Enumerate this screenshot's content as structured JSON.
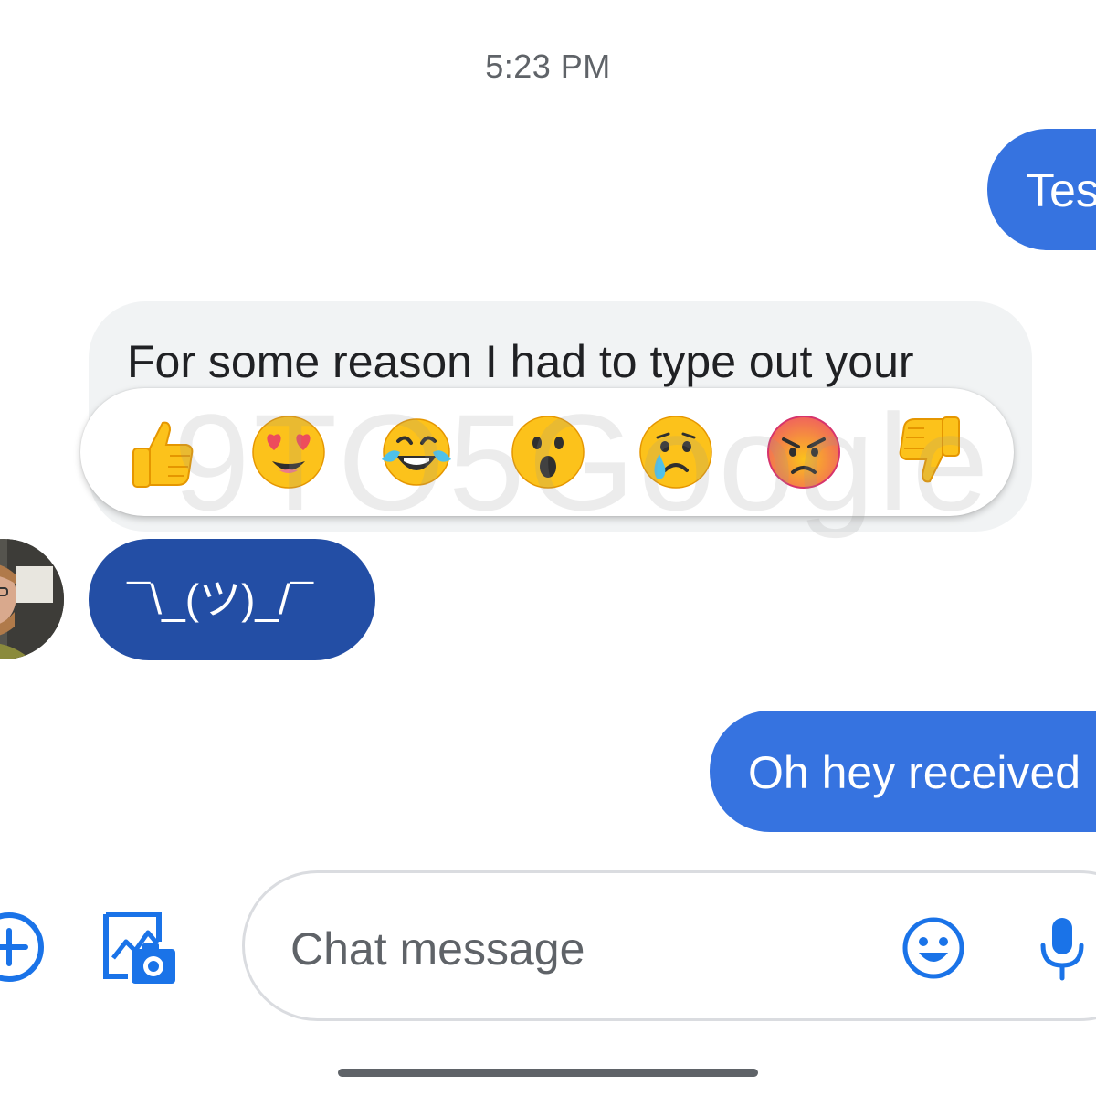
{
  "status": {
    "time": "5:23 PM"
  },
  "messages": {
    "outgoing_1": "Tes",
    "incoming_selected": "For some reason I had to type out your",
    "incoming_shrug": "¯\\_(ツ)_/¯",
    "outgoing_2": "Oh hey received"
  },
  "reactions": [
    {
      "name": "thumbs-up"
    },
    {
      "name": "heart-eyes"
    },
    {
      "name": "tears-of-joy"
    },
    {
      "name": "surprised"
    },
    {
      "name": "crying"
    },
    {
      "name": "angry"
    },
    {
      "name": "thumbs-down"
    }
  ],
  "watermark": "9TO5Google",
  "composer": {
    "placeholder": "Chat message",
    "icons": {
      "attach": "plus-circle-icon",
      "gallery": "gallery-camera-icon",
      "emoji": "smiley-icon",
      "voice": "microphone-icon"
    }
  },
  "colors": {
    "outgoing_bubble": "#3673e0",
    "incoming_bubble": "#f1f3f4",
    "highlighted_bubble": "#234ea5",
    "accent": "#1a73e8"
  }
}
